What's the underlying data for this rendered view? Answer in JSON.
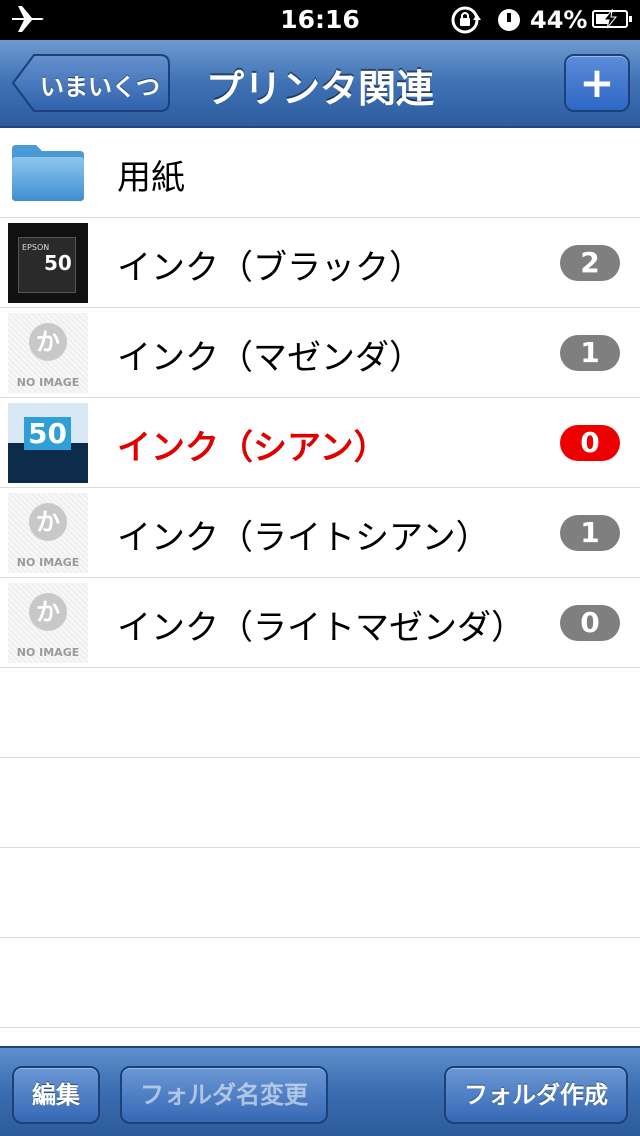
{
  "status_bar": {
    "time": "16:16",
    "battery_percent": "44%",
    "icons": [
      "airplane-icon",
      "rotation-lock-icon",
      "alarm-icon",
      "battery-charging-icon"
    ]
  },
  "nav": {
    "back_label": "いまいくつ",
    "title": "プリンタ関連",
    "add_label": "+"
  },
  "list": {
    "items": [
      {
        "label": "用紙",
        "type": "folder",
        "thumb": "folder-icon"
      },
      {
        "label": "インク（ブラック）",
        "count": "2",
        "thumb": "photo",
        "highlight": false
      },
      {
        "label": "インク（マゼンダ）",
        "count": "1",
        "thumb": "no-image",
        "highlight": false
      },
      {
        "label": "インク（シアン）",
        "count": "0",
        "thumb": "photo",
        "highlight": true
      },
      {
        "label": "インク（ライトシアン）",
        "count": "1",
        "thumb": "no-image",
        "highlight": false
      },
      {
        "label": "インク（ライトマゼンダ）",
        "count": "0",
        "thumb": "no-image",
        "highlight": false
      }
    ],
    "no_image_text": "NO IMAGE",
    "no_image_mark": "か",
    "photo_black_text": "50",
    "photo_black_brand": "EPSON",
    "photo_cyan_text": "50"
  },
  "toolbar": {
    "edit_label": "編集",
    "rename_label": "フォルダ名変更",
    "create_label": "フォルダ作成"
  },
  "colors": {
    "nav_blue": "#3f71b4",
    "badge_gray": "#7f7f7f",
    "badge_red": "#ee0000",
    "alert_text": "#e00000"
  }
}
